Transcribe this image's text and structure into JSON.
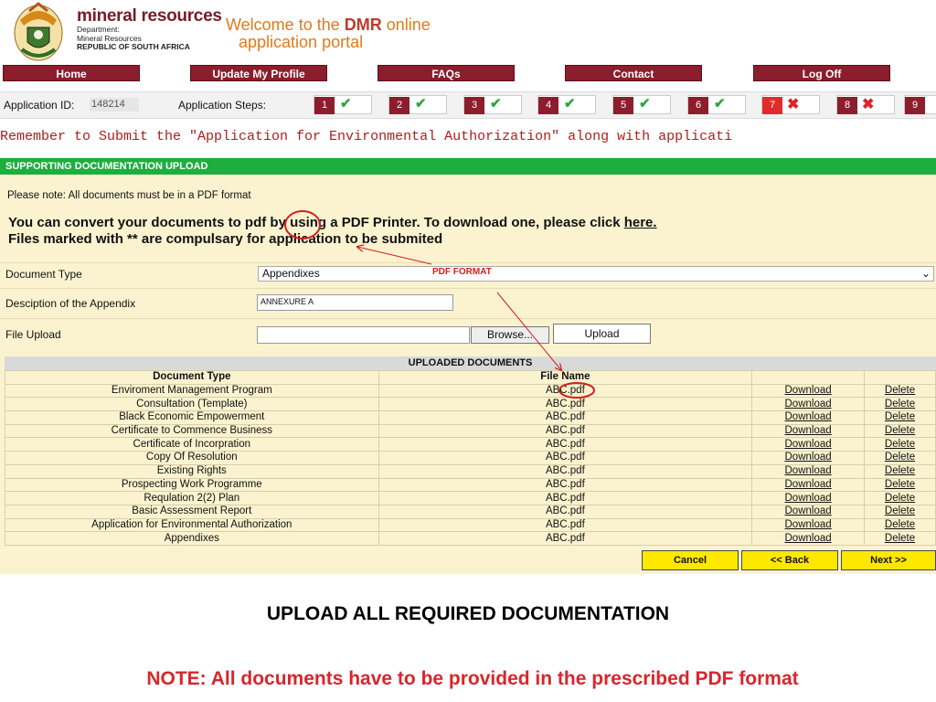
{
  "header": {
    "dept_name": "mineral resources",
    "dept_lines": [
      "Department:",
      "Mineral Resources",
      "REPUBLIC OF SOUTH AFRICA"
    ],
    "welcome_prefix": "Welcome to the ",
    "welcome_brand": "DMR",
    "welcome_suffix": " online",
    "welcome_line2": "application portal"
  },
  "nav": {
    "items": [
      "Home",
      "Update My Profile",
      "FAQs",
      "Contact",
      "Log Off"
    ]
  },
  "steps": {
    "app_id_label": "Application ID:",
    "app_id_value": "148214",
    "steps_label": "Application Steps:",
    "items": [
      {
        "n": "1",
        "status": "done"
      },
      {
        "n": "2",
        "status": "done"
      },
      {
        "n": "3",
        "status": "done"
      },
      {
        "n": "4",
        "status": "done"
      },
      {
        "n": "5",
        "status": "done"
      },
      {
        "n": "6",
        "status": "done"
      },
      {
        "n": "7",
        "status": "error"
      },
      {
        "n": "8",
        "status": "error"
      },
      {
        "n": "9",
        "status": "none"
      }
    ]
  },
  "reminder": "Remember to Submit the \"Application for Environmental Authorization\" along with applicati",
  "panel": {
    "header": "SUPPORTING DOCUMENTATION UPLOAD",
    "pdf_note": "Please note: All documents must be in a PDF format",
    "convert_line1_pre": "You can convert your documents to pdf by using a PDF Printer. To download one, please click ",
    "convert_link": "here.",
    "convert_line2": "Files marked with ** are compulsary for application to be submited"
  },
  "form": {
    "doc_type_label": "Document Type",
    "doc_type_value": "Appendixes",
    "desc_label": "Desciption of the Appendix",
    "desc_value": "ANNEXURE A",
    "file_label": "File Upload",
    "browse_label": "Browse...",
    "upload_label": "Upload"
  },
  "uploaded": {
    "title": "UPLOADED DOCUMENTS",
    "col_doc_type": "Document Type",
    "col_file_name": "File Name",
    "download_label": "Download",
    "delete_label": "Delete",
    "rows": [
      {
        "type": "Enviroment Management Program",
        "file": "ABC.pdf"
      },
      {
        "type": "Consultation (Template)",
        "file": "ABC.pdf"
      },
      {
        "type": "Black Economic Empowerment",
        "file": "ABC.pdf"
      },
      {
        "type": "Certificate to Commence Business",
        "file": "ABC.pdf"
      },
      {
        "type": "Certificate of Incorpration",
        "file": "ABC.pdf"
      },
      {
        "type": "Copy Of Resolution",
        "file": "ABC.pdf"
      },
      {
        "type": "Existing Rights",
        "file": "ABC.pdf"
      },
      {
        "type": "Prospecting Work Programme",
        "file": "ABC.pdf"
      },
      {
        "type": "Requlation 2(2) Plan",
        "file": "ABC.pdf"
      },
      {
        "type": "Basic Assessment Report",
        "file": "ABC.pdf"
      },
      {
        "type": "Application for Environmental Authorization",
        "file": "ABC.pdf"
      },
      {
        "type": "Appendixes",
        "file": "ABC.pdf"
      }
    ]
  },
  "footer_buttons": {
    "cancel": "Cancel",
    "back": "<< Back",
    "next": "Next >>"
  },
  "annotation": {
    "label": "PDF FORMAT"
  },
  "slide": {
    "title": "UPLOAD ALL REQUIRED DOCUMENTATION",
    "note": "NOTE: All documents have to be provided in the prescribed PDF format"
  },
  "colors": {
    "nav_bg": "#8c1d2c",
    "panel_header": "#1eae3f",
    "panel_bg": "#fbf3cf",
    "footer_button": "#ffe800",
    "annotation": "#d21f1f"
  },
  "icons": {
    "done": "check-icon",
    "error": "cross-icon"
  }
}
